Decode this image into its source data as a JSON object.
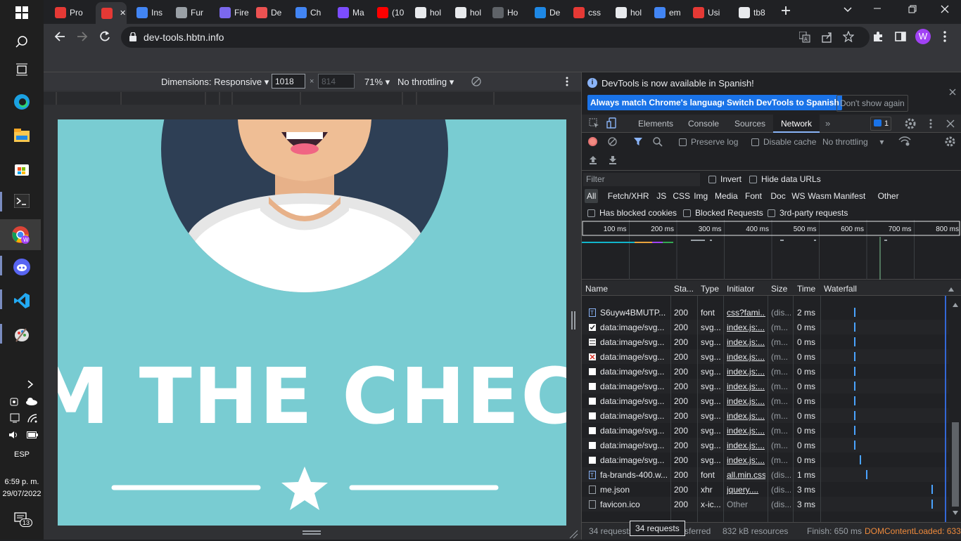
{
  "taskbar": {
    "lang": "ESP",
    "time": "6:59 p. m.",
    "date": "29/07/2022",
    "notification_count": "13"
  },
  "tabs": [
    {
      "label": "Pro",
      "icon": "brand-icon",
      "color": "#e53935"
    },
    {
      "label": "",
      "icon": "brand-icon",
      "color": "#e53935"
    },
    {
      "label": "Ins",
      "icon": "chrome-icon",
      "color": "#4285f4"
    },
    {
      "label": "Fur",
      "icon": "book-icon",
      "color": "#9aa0a6"
    },
    {
      "label": "Fire",
      "icon": "firefox-icon",
      "color": "#7b68ee"
    },
    {
      "label": "De",
      "icon": "udemy-icon",
      "color": "#ec5252"
    },
    {
      "label": "Ch",
      "icon": "chrome-icon",
      "color": "#4285f4"
    },
    {
      "label": "Ma",
      "icon": "app-icon",
      "color": "#7c4dff"
    },
    {
      "label": "(10",
      "icon": "youtube-icon",
      "color": "#ff0000"
    },
    {
      "label": "hol",
      "icon": "github-icon",
      "color": "#e8eaed"
    },
    {
      "label": "hol",
      "icon": "github-icon",
      "color": "#e8eaed"
    },
    {
      "label": "Ho",
      "icon": "page-icon",
      "color": "#5f6368"
    },
    {
      "label": "De",
      "icon": "shield-icon",
      "color": "#1e88e5"
    },
    {
      "label": "css",
      "icon": "brand-icon",
      "color": "#e53935"
    },
    {
      "label": "hol",
      "icon": "github-icon",
      "color": "#e8eaed"
    },
    {
      "label": "em",
      "icon": "google-icon",
      "color": "#4285f4"
    },
    {
      "label": "Usi",
      "icon": "brand-icon",
      "color": "#e53935"
    },
    {
      "label": "tb8",
      "icon": "tab-icon",
      "color": "#e8eaed"
    }
  ],
  "omnibox": {
    "url": "dev-tools.hbtn.info"
  },
  "profile": {
    "initial": "W",
    "color": "#a142f4"
  },
  "device_toolbar": {
    "dimensions": "Dimensions: Responsive",
    "width": "1018",
    "height": "814",
    "zoom": "71%",
    "throttling": "No throttling"
  },
  "page": {
    "heading": "M THE CHEC"
  },
  "infobar": {
    "message": "DevTools is now available in Spanish!",
    "btn_match": "Always match Chrome's language",
    "btn_switch": "Switch DevTools to Spanish",
    "btn_dismiss": "Don't show again"
  },
  "devtools_tabs": [
    "Elements",
    "Console",
    "Sources",
    "Network"
  ],
  "issues_count": "1",
  "network": {
    "preserve_log": "Preserve log",
    "disable_cache": "Disable cache",
    "throttling": "No throttling",
    "filter_placeholder": "Filter",
    "invert": "Invert",
    "hide_data_urls": "Hide data URLs",
    "types": [
      "All",
      "Fetch/XHR",
      "JS",
      "CSS",
      "Img",
      "Media",
      "Font",
      "Doc",
      "WS",
      "Wasm",
      "Manifest",
      "Other"
    ],
    "has_blocked_cookies": "Has blocked cookies",
    "blocked_requests": "Blocked Requests",
    "third_party": "3rd-party requests",
    "overview_ticks": [
      "100 ms",
      "200 ms",
      "300 ms",
      "400 ms",
      "500 ms",
      "600 ms",
      "700 ms",
      "800 ms"
    ],
    "columns": [
      "Name",
      "Sta...",
      "Type",
      "Initiator",
      "Size",
      "Time",
      "Waterfall"
    ],
    "rows": [
      {
        "name": "S6uyw4BMUTP...",
        "status": "200",
        "type": "font",
        "initiator": "css?fami...",
        "size": "(dis...",
        "time": "2 ms",
        "icon": "font-file-icon",
        "wf": 0.25
      },
      {
        "name": "data:image/svg...",
        "status": "200",
        "type": "svg...",
        "initiator": "index.js:...",
        "size": "(m...",
        "time": "0 ms",
        "icon": "checkbox-icon",
        "wf": 0.25
      },
      {
        "name": "data:image/svg...",
        "status": "200",
        "type": "svg...",
        "initiator": "index.js:...",
        "size": "(m...",
        "time": "0 ms",
        "icon": "grid-icon",
        "wf": 0.25
      },
      {
        "name": "data:image/svg...",
        "status": "200",
        "type": "svg...",
        "initiator": "index.js:...",
        "size": "(m...",
        "time": "0 ms",
        "icon": "close-icon",
        "wf": 0.25
      },
      {
        "name": "data:image/svg...",
        "status": "200",
        "type": "svg...",
        "initiator": "index.js:...",
        "size": "(m...",
        "time": "0 ms",
        "icon": "square-icon",
        "wf": 0.25
      },
      {
        "name": "data:image/svg...",
        "status": "200",
        "type": "svg...",
        "initiator": "index.js:...",
        "size": "(m...",
        "time": "0 ms",
        "icon": "square-icon",
        "wf": 0.25
      },
      {
        "name": "data:image/svg...",
        "status": "200",
        "type": "svg...",
        "initiator": "index.js:...",
        "size": "(m...",
        "time": "0 ms",
        "icon": "square-icon",
        "wf": 0.25
      },
      {
        "name": "data:image/svg...",
        "status": "200",
        "type": "svg...",
        "initiator": "index.js:...",
        "size": "(m...",
        "time": "0 ms",
        "icon": "square-icon",
        "wf": 0.25
      },
      {
        "name": "data:image/svg...",
        "status": "200",
        "type": "svg...",
        "initiator": "index.js:...",
        "size": "(m...",
        "time": "0 ms",
        "icon": "square-icon",
        "wf": 0.25
      },
      {
        "name": "data:image/svg...",
        "status": "200",
        "type": "svg...",
        "initiator": "index.js:...",
        "size": "(m...",
        "time": "0 ms",
        "icon": "square-icon",
        "wf": 0.25
      },
      {
        "name": "data:image/svg...",
        "status": "200",
        "type": "svg...",
        "initiator": "index.js:...",
        "size": "(m...",
        "time": "0 ms",
        "icon": "square-icon",
        "wf": 0.3
      },
      {
        "name": "fa-brands-400.w...",
        "status": "200",
        "type": "font",
        "initiator": "all.min.css",
        "size": "(dis...",
        "time": "1 ms",
        "icon": "font-file-icon",
        "wf": 0.35
      },
      {
        "name": "me.json",
        "status": "200",
        "type": "xhr",
        "initiator": "jquery....",
        "size": "(dis...",
        "time": "3 ms",
        "icon": "doc-icon",
        "wf": 0.9
      },
      {
        "name": "favicon.ico",
        "status": "200",
        "type": "x-ic...",
        "initiator": "Other",
        "size": "(dis...",
        "time": "3 ms",
        "icon": "doc-icon",
        "wf": 0.9
      }
    ],
    "status": {
      "requests": "34 requests",
      "transferred": "sferred",
      "resources": "832 kB resources",
      "finish": "Finish: 650 ms",
      "dcl": "DOMContentLoaded: 633"
    },
    "tooltip": "34 requests"
  }
}
